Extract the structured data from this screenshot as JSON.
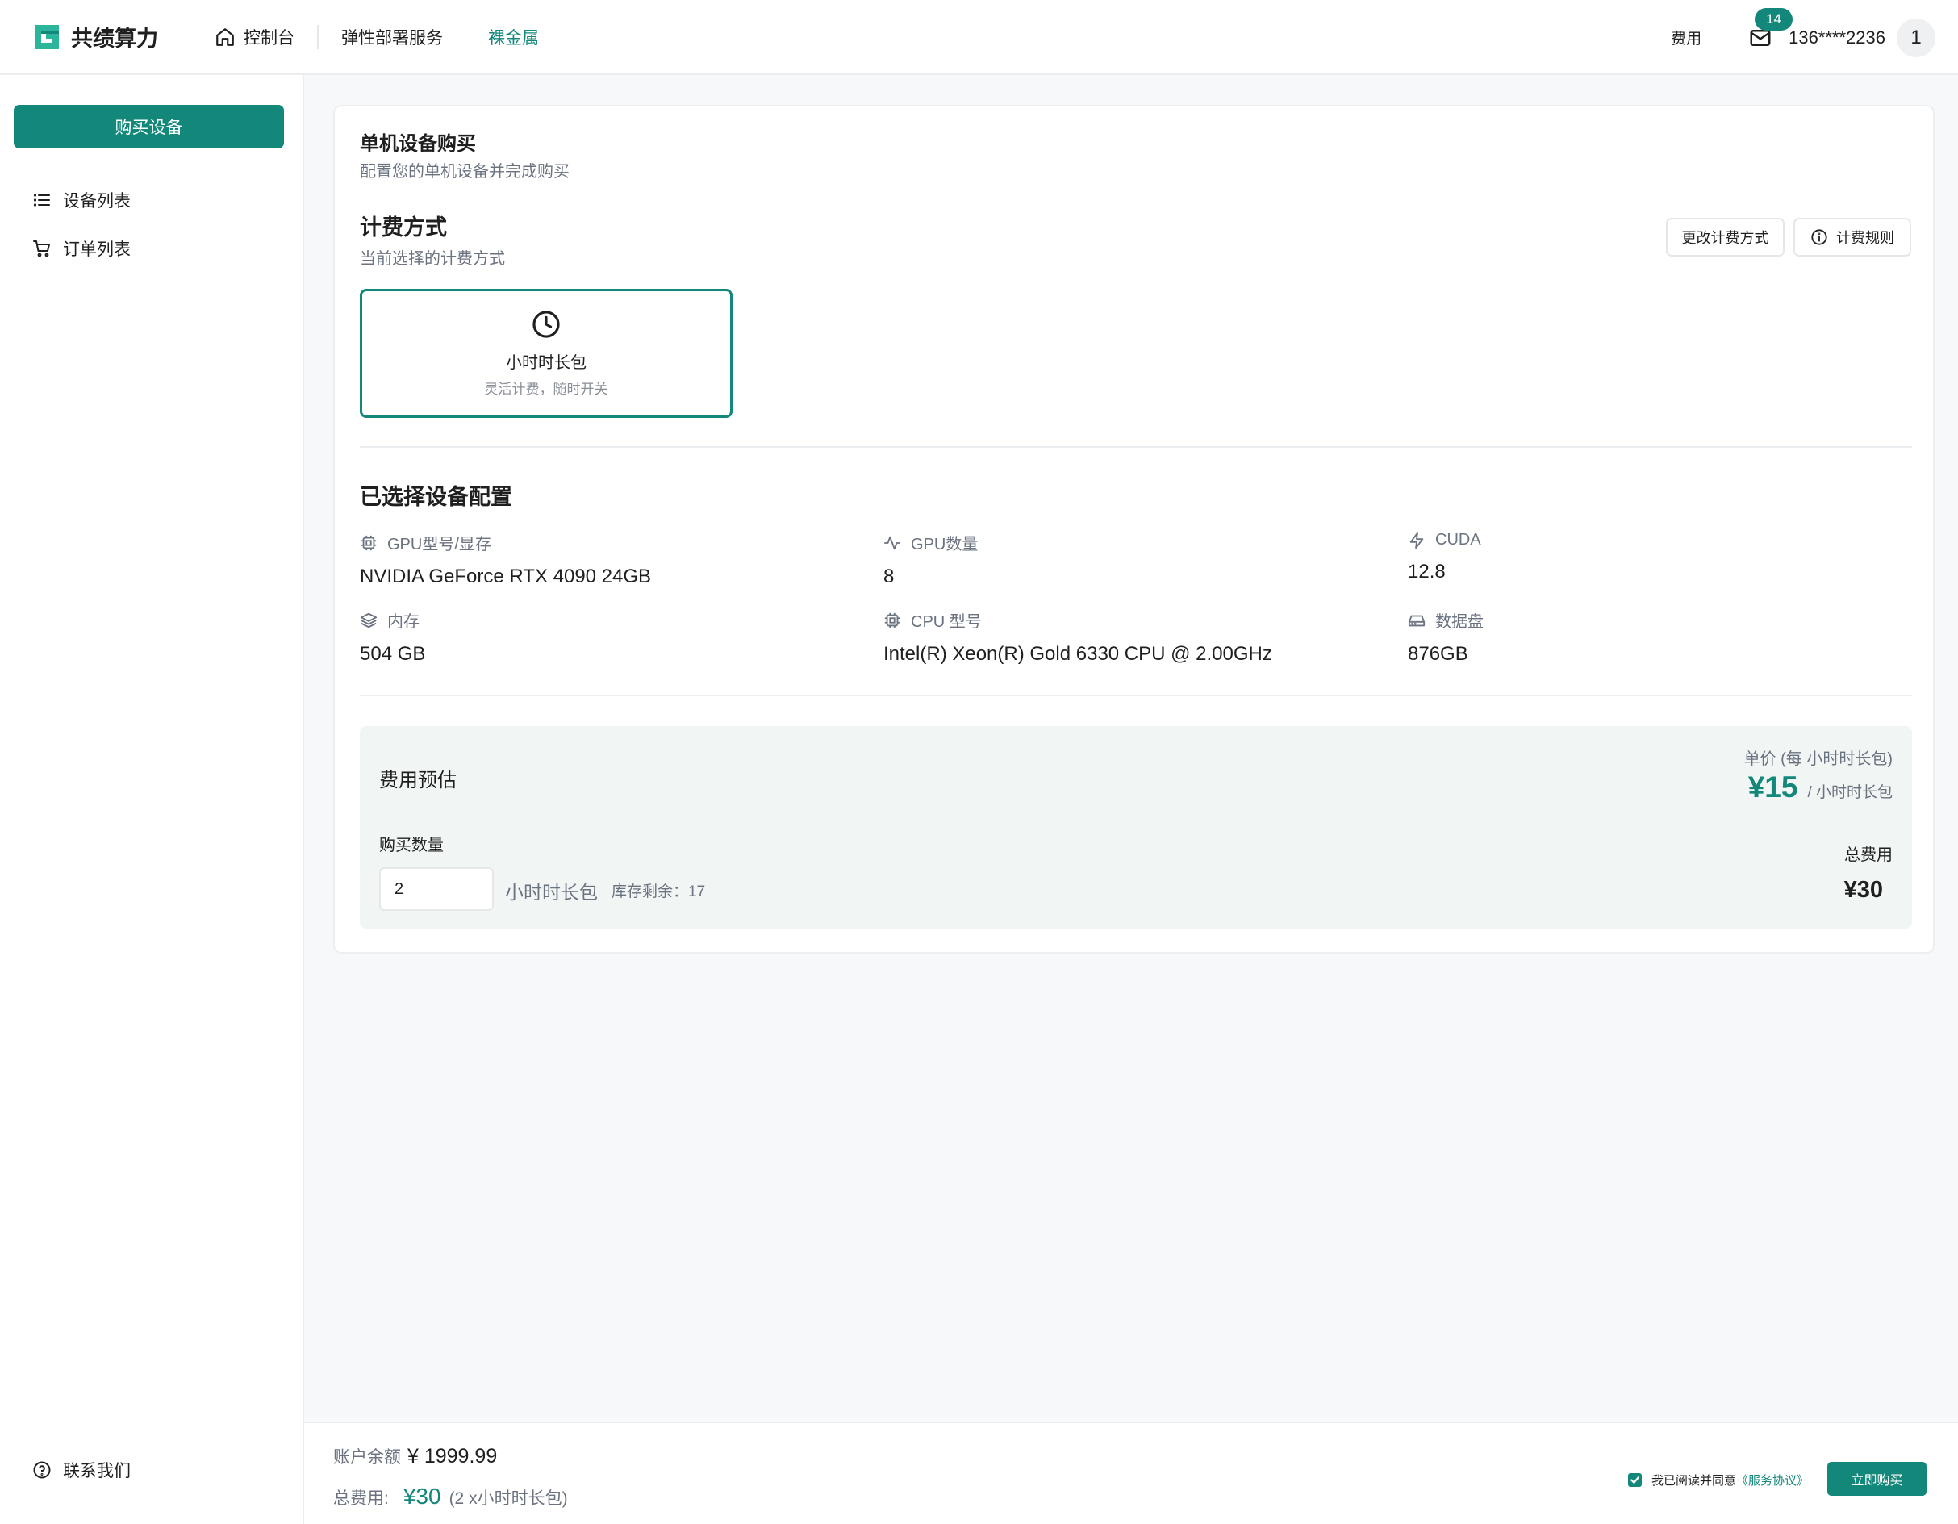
{
  "app": {
    "brand": "共绩算力"
  },
  "nav": {
    "items": [
      {
        "label": "控制台"
      },
      {
        "label": "弹性部署服务"
      },
      {
        "label": "裸金属"
      }
    ]
  },
  "topright": {
    "fee_label": "费用",
    "mail_badge": "14",
    "user_phone": "136****2236",
    "avatar_text": "1"
  },
  "sidebar": {
    "buy_button": "购买设备",
    "items": [
      {
        "label": "设备列表",
        "icon": "list-icon"
      },
      {
        "label": "订单列表",
        "icon": "cart-icon"
      }
    ],
    "contact": "联系我们"
  },
  "page": {
    "title": "单机设备购买",
    "subtitle": "配置您的单机设备并完成购买"
  },
  "billing": {
    "title": "计费方式",
    "subtitle": "当前选择的计费方式",
    "change_button": "更改计费方式",
    "rules_button": "计费规则",
    "plan": {
      "name": "小时时长包",
      "desc": "灵活计费，随时开关",
      "icon": "clock-icon"
    }
  },
  "config": {
    "title": "已选择设备配置",
    "specs": [
      {
        "label": "GPU型号/显存",
        "value": "NVIDIA GeForce RTX 4090 24GB",
        "icon": "chip-icon"
      },
      {
        "label": "GPU数量",
        "value": "8",
        "icon": "activity-icon"
      },
      {
        "label": "CUDA",
        "value": "12.8",
        "icon": "bolt-icon"
      },
      {
        "label": "内存",
        "value": "504 GB",
        "icon": "layers-icon"
      },
      {
        "label": "CPU 型号",
        "value": "Intel(R) Xeon(R) Gold 6330 CPU @ 2.00GHz",
        "icon": "chip-icon"
      },
      {
        "label": "数据盘",
        "value": "876GB",
        "icon": "disk-icon"
      }
    ]
  },
  "estimate": {
    "title": "费用预估",
    "unit_label": "单价 (每 小时时长包)",
    "unit_price": "¥15",
    "unit_per": "/ 小时时长包",
    "qty_label": "购买数量",
    "qty_value": "2",
    "qty_unit": "小时时长包",
    "stock": "库存剩余：17",
    "total_label": "总费用",
    "total_value": "¥30"
  },
  "footer": {
    "balance_label": "账户余额",
    "balance_value": "¥ 1999.99",
    "total_label": "总费用:",
    "total_value": "¥30",
    "total_note": "(2 x小时时长包)",
    "agree_text": "我已阅读并同意",
    "agree_link": "《服务协议》",
    "agree_checked": true,
    "buy_now": "立即购买"
  },
  "colors": {
    "accent": "#12877a",
    "bg": "#f7f8f9",
    "estimate_bg": "#f1f6f5"
  }
}
